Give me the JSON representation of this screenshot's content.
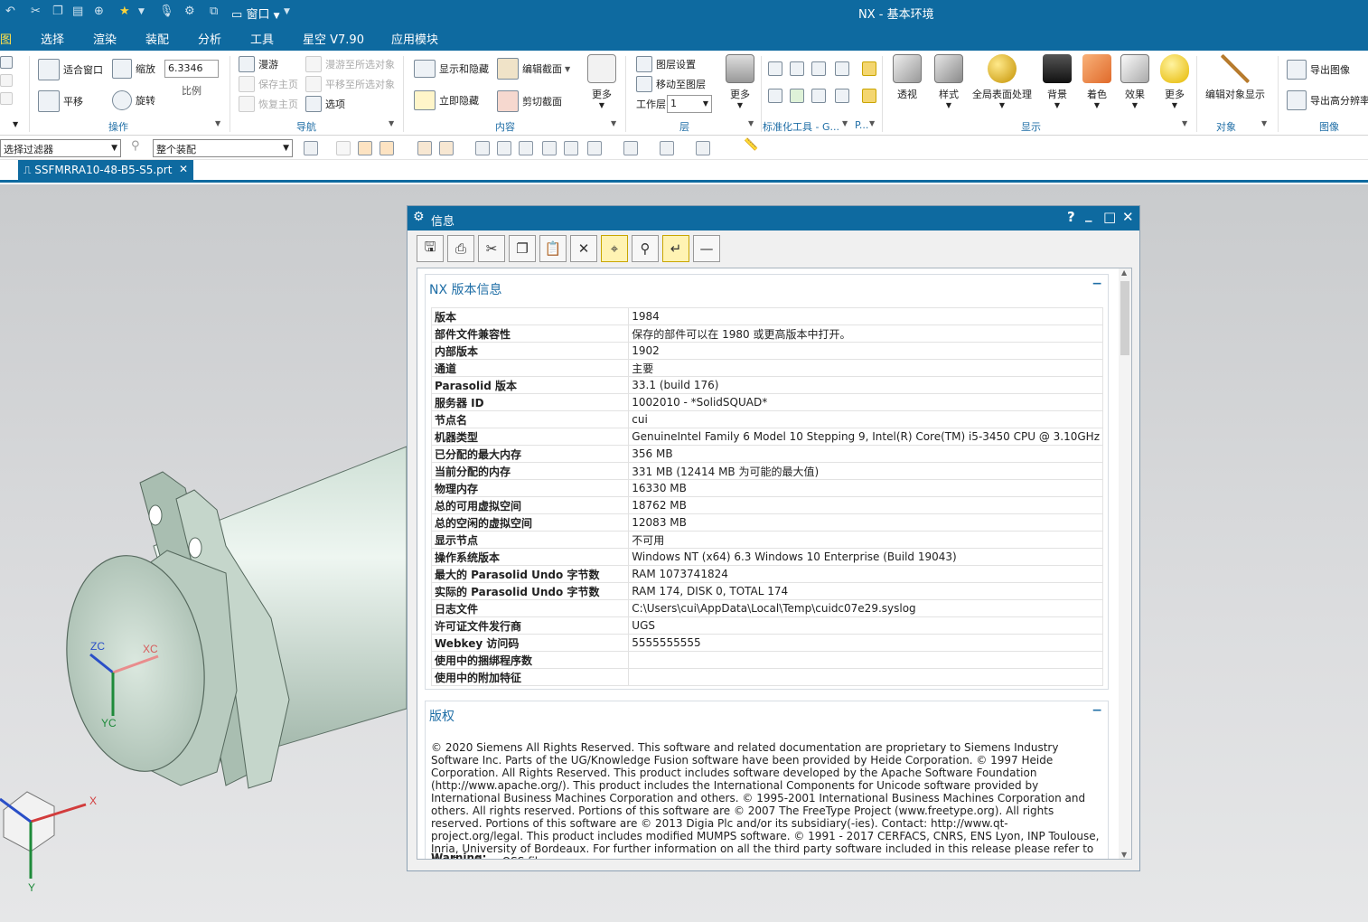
{
  "app": {
    "title": "NX - 基本环境",
    "quick_access": {
      "window_label": "窗口"
    }
  },
  "menu": [
    "图",
    "选择",
    "渲染",
    "装配",
    "分析",
    "工具",
    "星空 V7.90",
    "应用模块"
  ],
  "ribbon": {
    "operation": {
      "fit": "适合窗口",
      "zoom": "缩放",
      "zoom_value": "6.3346",
      "scale": "比例",
      "pan": "平移",
      "rotate": "旋转",
      "group": "操作"
    },
    "navigation": {
      "roam": "漫游",
      "save_view": "保存主页",
      "restore_view": "恢复主页",
      "roam_to_selected": "漫游至所选对象",
      "pan_to_selected": "平移至所选对象",
      "options": "选项",
      "group": "导航"
    },
    "content": {
      "show_hide": "显示和隐藏",
      "edit_section": "编辑截面",
      "immediate_hide": "立即隐藏",
      "clip_section": "剪切截面",
      "more": "更多",
      "group": "内容"
    },
    "layer": {
      "settings": "图层设置",
      "move_to_layer": "移动至图层",
      "work_layer": "工作层",
      "work_layer_value": "1",
      "more": "更多",
      "group": "层"
    },
    "std_tools": {
      "group": "标准化工具 - G...",
      "group2": "P..."
    },
    "display": {
      "perspective": "透视",
      "style": "样式",
      "global_shading": "全局表面处理",
      "background": "背景",
      "coloring": "着色",
      "effects": "效果",
      "more": "更多",
      "group": "显示"
    },
    "object": {
      "edit_display": "编辑对象显示",
      "group": "对象"
    },
    "image": {
      "export_image": "导出图像",
      "export_hq": "导出高分辨率",
      "group": "图像"
    }
  },
  "toolbar2": {
    "filter": "选择过滤器",
    "scope": "整个装配"
  },
  "file_tab": {
    "name": "SSFMRRA10-48-B5-S5.prt"
  },
  "viewport": {
    "zc": "ZC",
    "xc": "XC",
    "yc": "YC",
    "x": "X",
    "y": "Y"
  },
  "dialog": {
    "title": "信息",
    "controls": {
      "help": "?",
      "minimize": "_",
      "maximize": "□",
      "close": "✕"
    },
    "nx_section": {
      "title": "NX 版本信息",
      "rows": [
        {
          "key": "版本",
          "value": "1984"
        },
        {
          "key": "部件文件兼容性",
          "value": "保存的部件可以在 1980 或更高版本中打开。"
        },
        {
          "key": "内部版本",
          "value": "1902"
        },
        {
          "key": "通道",
          "value": "主要"
        },
        {
          "key": "Parasolid 版本",
          "value": "33.1 (build 176)"
        },
        {
          "key": "服务器 ID",
          "value": "1002010 - *SolidSQUAD*"
        },
        {
          "key": "节点名",
          "value": "cui"
        },
        {
          "key": "机器类型",
          "value": "GenuineIntel Family 6 Model 10 Stepping 9, Intel(R) Core(TM) i5-3450 CPU @ 3.10GHz"
        },
        {
          "key": "已分配的最大内存",
          "value": "356 MB"
        },
        {
          "key": "当前分配的内存",
          "value": "331 MB (12414 MB 为可能的最大值)"
        },
        {
          "key": "物理内存",
          "value": "16330 MB"
        },
        {
          "key": "总的可用虚拟空间",
          "value": "18762 MB"
        },
        {
          "key": "总的空闲的虚拟空间",
          "value": "12083 MB"
        },
        {
          "key": "显示节点",
          "value": "不可用"
        },
        {
          "key": "操作系统版本",
          "value": "Windows NT (x64) 6.3 Windows 10 Enterprise (Build 19043)"
        },
        {
          "key": "最大的 Parasolid Undo 字节数",
          "value": "RAM 1073741824"
        },
        {
          "key": "实际的 Parasolid Undo 字节数",
          "value": "RAM 174, DISK 0, TOTAL 174"
        },
        {
          "key": "日志文件",
          "value": "C:\\Users\\cui\\AppData\\Local\\Temp\\cuidc07e29.syslog"
        },
        {
          "key": "许可证文件发行商",
          "value": "UGS"
        },
        {
          "key": "Webkey 访问码",
          "value": "5555555555"
        },
        {
          "key": "使用中的捆绑程序数",
          "value": ""
        },
        {
          "key": "使用中的附加特征",
          "value": ""
        }
      ]
    },
    "copyright_section": {
      "title": "版权",
      "text": "© 2020 Siemens All Rights Reserved. This software and related documentation are proprietary to Siemens Industry Software Inc. Parts of the UG/Knowledge Fusion software have been provided by Heide Corporation. © 1997 Heide Corporation. All Rights Reserved. This product includes software developed by the Apache Software Foundation (http://www.apache.org/). This product includes the International Components for Unicode software provided by International Business Machines Corporation and others. © 1995-2001 International Business Machines Corporation and others. All rights reserved. Portions of this software are © 2007 The FreeType Project (www.freetype.org). All rights reserved. Portions of this software are © 2013 Digia Plc and/or its subsidiary(-ies). Contact: http://www.qt-project.org/legal. This product includes modified MUMPS software. © 1991 - 2017 CERFACS, CNRS, ENS Lyon, INP Toulouse, Inria, University of Bordeaux. For further information on all the third party software included in this release please refer to the Readme_OSS file.",
      "warning": "Warning:"
    },
    "collapse_glyph": "−"
  },
  "colors": {
    "brand": "#0e6aa0",
    "accent": "#ffe14a",
    "section_title": "#1f6ea6"
  }
}
